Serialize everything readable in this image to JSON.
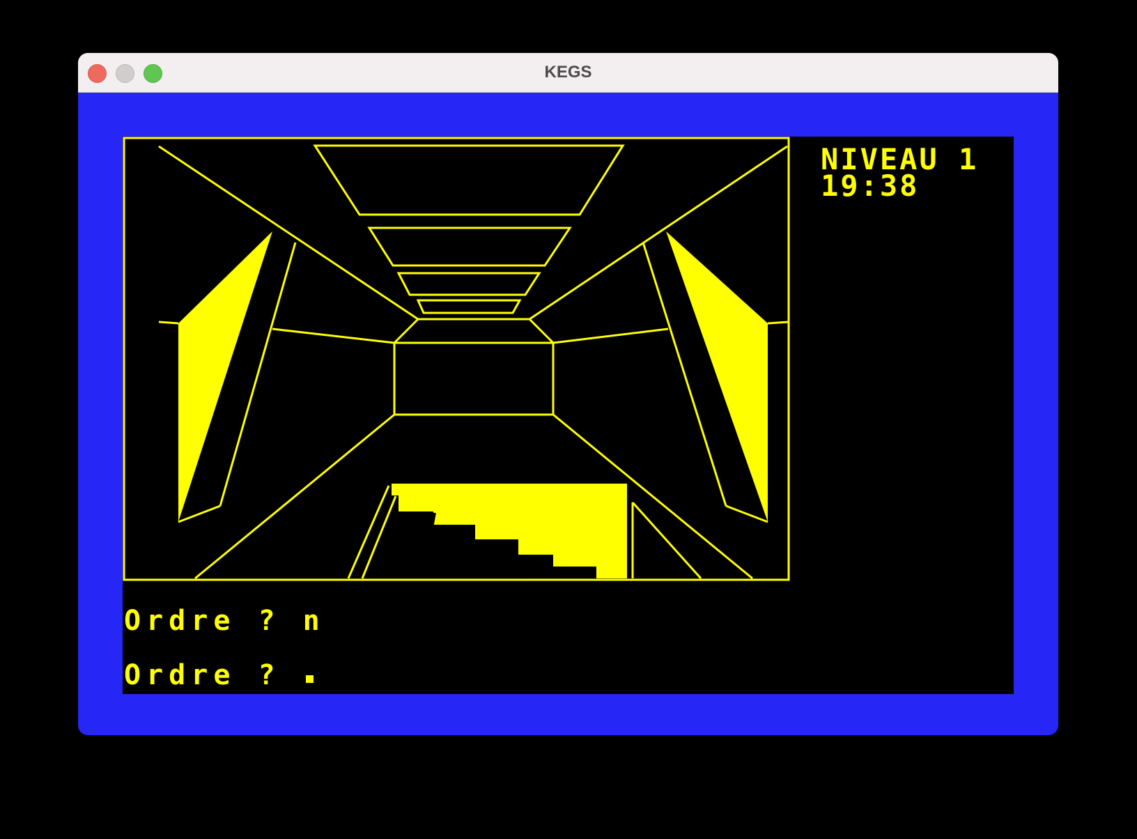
{
  "window": {
    "title": "KEGS",
    "controls": [
      "close",
      "minimize",
      "zoom"
    ]
  },
  "game": {
    "level_label": "NIVEAU 1",
    "time": "19:38",
    "console": [
      {
        "prompt": "Ordre ?",
        "input": "n"
      },
      {
        "prompt": "Ordre ?",
        "input": ""
      }
    ],
    "colors": {
      "border": "#2626f7",
      "screen": "#000000",
      "ink": "#ffff00"
    }
  }
}
